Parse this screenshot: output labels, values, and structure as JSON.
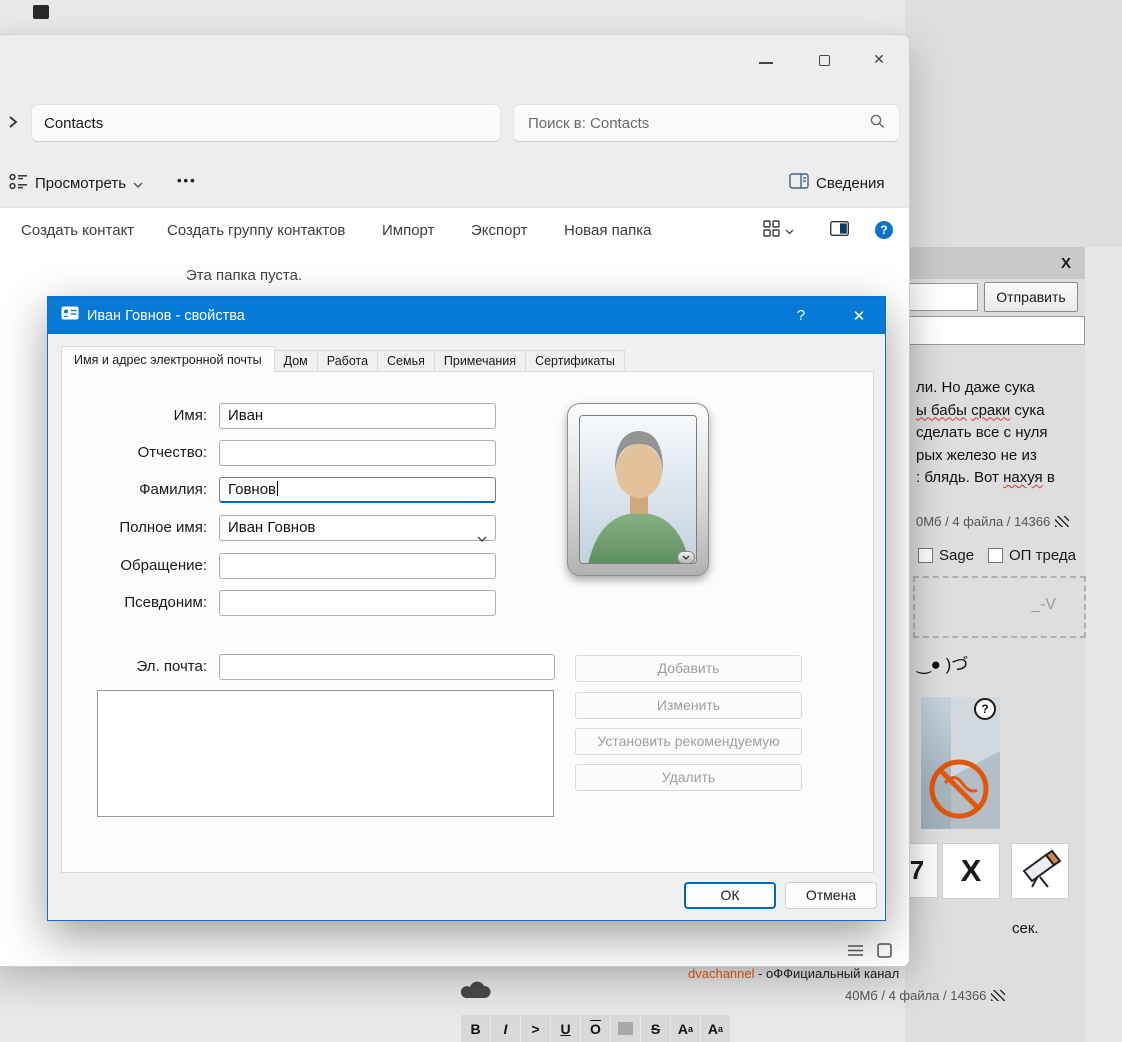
{
  "explorer": {
    "caption": {
      "close": "✕"
    },
    "breadcrumb": {
      "label": "Contacts"
    },
    "search": {
      "placeholder": "Поиск в: Contacts"
    },
    "ribbon": {
      "view": "Просмотреть",
      "more": "•••",
      "details": "Сведения",
      "help": "?"
    },
    "commands": [
      "Создать контакт",
      "Создать группу контактов",
      "Импорт",
      "Экспорт",
      "Новая папка"
    ],
    "empty_text": "Эта папка пуста."
  },
  "dialog": {
    "title": "Иван Говнов - свойства",
    "help": "?",
    "close": "✕",
    "tabs": [
      "Имя и адрес электронной почты",
      "Дом",
      "Работа",
      "Семья",
      "Примечания",
      "Сертификаты"
    ],
    "fields": [
      {
        "label": "Имя:",
        "value": "Иван"
      },
      {
        "label": "Отчество:",
        "value": ""
      },
      {
        "label": "Фамилия:",
        "value": "Говнов"
      },
      {
        "label": "Полное имя:",
        "value": "Иван Говнов"
      },
      {
        "label": "Обращение:",
        "value": ""
      },
      {
        "label": "Псевдоним:",
        "value": ""
      }
    ],
    "email_label": "Эл. почта:",
    "actions": [
      "Добавить",
      "Изменить",
      "Установить рекомендуемую",
      "Удалить"
    ],
    "ok": "ОК",
    "cancel": "Отмена"
  },
  "board": {
    "panel_close": "X",
    "send": "Отправить",
    "post": {
      "line1": "ли. Но даже сука",
      "line2a": "ы бабы",
      "line2b": " ",
      "line2c": "сраки",
      "line2d": " сука",
      "line3": "сделать все с нуля",
      "line4": "рых железо не из",
      "line5a": ": блядь. Вот ",
      "line5b": "нахуя",
      "line5c": " в"
    },
    "files_top": "0Мб / 4 файла / 14366",
    "sage": "Sage",
    "op": "ОП треда",
    "dropzone": "_-V",
    "emoticon": "‿● )づ",
    "badge": "?",
    "card7": "7",
    "cardx": "X",
    "countdown": "сек.",
    "channel_link": "dvachannel",
    "channel_rest": " - оФФициальный канал",
    "files_bottom": "40Мб / 4 файла / 14366",
    "format": [
      "B",
      "I",
      ">",
      "U",
      "O",
      "",
      "S",
      "A",
      "A"
    ],
    "format_sup": "a",
    "format_sub": "a"
  }
}
